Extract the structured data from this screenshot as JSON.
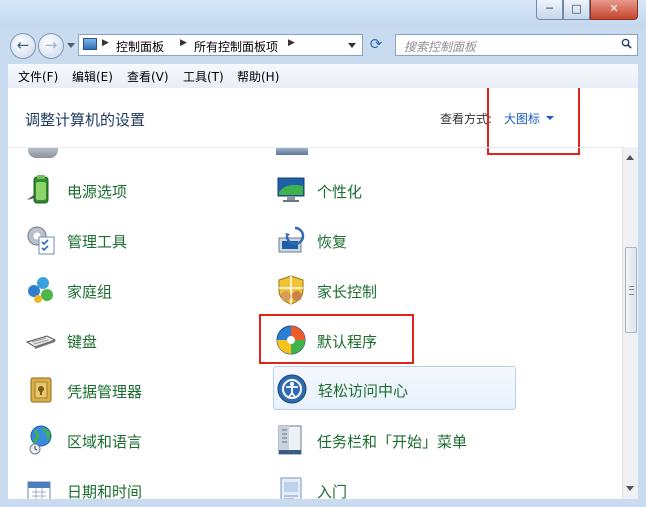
{
  "window": {
    "minimize_label": "─",
    "maximize_label": "□",
    "close_label": "✕"
  },
  "nav": {
    "back_label": "←",
    "forward_label": "→",
    "breadcrumb": [
      "控制面板",
      "所有控制面板项"
    ],
    "refresh_label": "⟳",
    "search_placeholder": "搜索控制面板"
  },
  "menu": [
    "文件(F)",
    "编辑(E)",
    "查看(V)",
    "工具(T)",
    "帮助(H)"
  ],
  "header": {
    "title": "调整计算机的设置",
    "view_by_label": "查看方式:",
    "view_by_value": "大图标"
  },
  "items": {
    "left": [
      "电源选项",
      "管理工具",
      "家庭组",
      "键盘",
      "凭据管理器",
      "区域和语言",
      "日期和时间"
    ],
    "right": [
      "个性化",
      "恢复",
      "家长控制",
      "默认程序",
      "轻松访问中心",
      "任务栏和「开始」菜单",
      "入门"
    ]
  },
  "colors": {
    "item_text": "#1b6d2f",
    "link_blue": "#1a5bbf",
    "highlight_red": "#e0231b"
  },
  "icons": {
    "left": [
      "power-options-icon",
      "admin-tools-icon",
      "homegroup-icon",
      "keyboard-icon",
      "credential-manager-icon",
      "region-language-icon",
      "date-time-icon"
    ],
    "right": [
      "personalization-icon",
      "recovery-icon",
      "parental-controls-icon",
      "default-programs-icon",
      "ease-of-access-icon",
      "taskbar-start-menu-icon",
      "getting-started-icon"
    ]
  }
}
